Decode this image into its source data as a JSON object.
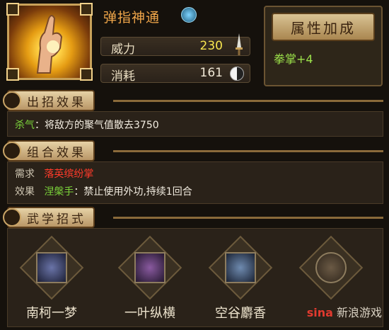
{
  "skill": {
    "name": "弹指神通",
    "type_icon": "fist-emblem-icon"
  },
  "stats": {
    "power_label": "威力",
    "power_value": "230",
    "power_icon": "sword-icon",
    "cost_label": "消耗",
    "cost_value": "161",
    "cost_icon": "yin-yang-icon"
  },
  "attribute_panel": {
    "title": "属性加成",
    "bonus": "拳掌+4"
  },
  "effect_section": {
    "title": "出招效果",
    "key": "杀气",
    "text": "：将敌方的聚气值散去3750"
  },
  "combo_section": {
    "title": "组合效果",
    "requirement_label": "需求",
    "requirement_value": "落英缤纷掌",
    "effect_label": "效果",
    "effect_name": "涅槃手",
    "effect_text": "：禁止使用外功,持续1回合"
  },
  "moves_section": {
    "title": "武学招式",
    "moves": [
      {
        "name": "南柯一梦"
      },
      {
        "name": "一叶纵横"
      },
      {
        "name": "空谷麝香"
      },
      {
        "name": ""
      }
    ]
  },
  "watermark": {
    "brand": "sina",
    "text": "新浪游戏"
  }
}
